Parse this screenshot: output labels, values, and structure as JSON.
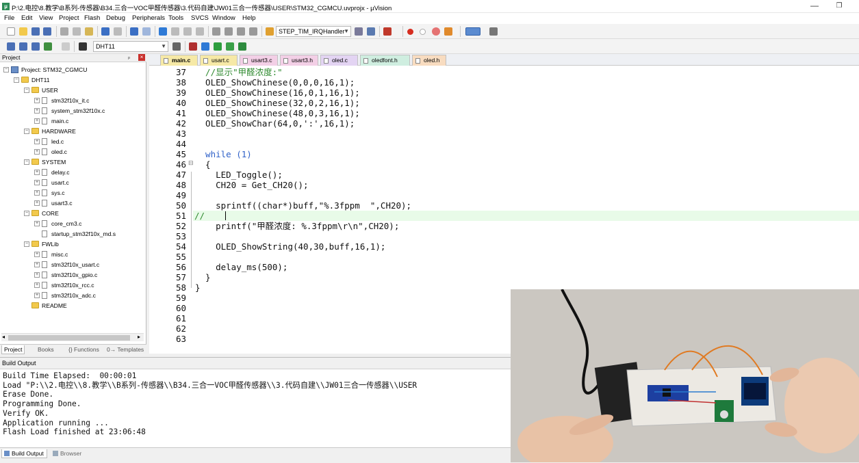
{
  "window": {
    "title": "P:\\2.电控\\8.教学\\B系列-传感器\\B34.三合一VOC甲醛传感器\\3.代码自建\\JW01三合一传感器\\USER\\STM32_CGMCU.uvprojx - µVision",
    "minimize_glyph": "—",
    "restore_glyph": "❐"
  },
  "menu": [
    "File",
    "Edit",
    "View",
    "Project",
    "Flash",
    "Debug",
    "Peripherals",
    "Tools",
    "SVCS",
    "Window",
    "Help"
  ],
  "toolbar": {
    "function_combo": "STEP_TIM_IRQHandler",
    "target_combo": "DHT11"
  },
  "project": {
    "panel_title": "Project",
    "pin_glyph": "ᵖ",
    "close_glyph": "×",
    "root": "Project: STM32_CGMCU",
    "target": "DHT11",
    "groups": [
      {
        "name": "USER",
        "files": [
          "stm32f10x_it.c",
          "system_stm32f10x.c",
          "main.c"
        ]
      },
      {
        "name": "HARDWARE",
        "files": [
          "led.c",
          "oled.c"
        ]
      },
      {
        "name": "SYSTEM",
        "files": [
          "delay.c",
          "usart.c",
          "sys.c",
          "usart3.c"
        ]
      },
      {
        "name": "CORE",
        "files": [
          "core_cm3.c",
          "startup_stm32f10x_md.s"
        ]
      },
      {
        "name": "FWLib",
        "files": [
          "misc.c",
          "stm32f10x_usart.c",
          "stm32f10x_gpio.c",
          "stm32f10x_rcc.c",
          "stm32f10x_adc.c"
        ]
      },
      {
        "name": "README",
        "files": []
      }
    ],
    "tabs": [
      "Project",
      "Books",
      "{} Functions",
      "0→ Templates"
    ]
  },
  "editor": {
    "tabs": [
      {
        "label": "main.c",
        "color": "#f6e9a6",
        "active": true
      },
      {
        "label": "usart.c",
        "color": "#f6e9a6",
        "active": false
      },
      {
        "label": "usart3.c",
        "color": "#f3cfe6",
        "active": false
      },
      {
        "label": "usart3.h",
        "color": "#f3cfe6",
        "active": false
      },
      {
        "label": "oled.c",
        "color": "#e3d4f3",
        "active": false
      },
      {
        "label": "oledfont.h",
        "color": "#cfeee0",
        "active": false
      },
      {
        "label": "oled.h",
        "color": "#f8dcc0",
        "active": false
      }
    ],
    "fold_markers": [
      "⊟",
      "⊟"
    ],
    "code_lines": [
      {
        "n": "37",
        "text": "  //显示\"甲醛浓度:\""
      },
      {
        "n": "38",
        "text": "  OLED_ShowChinese(0,0,0,16,1);"
      },
      {
        "n": "39",
        "text": "  OLED_ShowChinese(16,0,1,16,1);"
      },
      {
        "n": "40",
        "text": "  OLED_ShowChinese(32,0,2,16,1);"
      },
      {
        "n": "41",
        "text": "  OLED_ShowChinese(48,0,3,16,1);"
      },
      {
        "n": "42",
        "text": "  OLED_ShowChar(64,0,':',16,1);"
      },
      {
        "n": "43",
        "text": ""
      },
      {
        "n": "44",
        "text": ""
      },
      {
        "n": "45",
        "text": "  while (1)"
      },
      {
        "n": "46",
        "text": "  {"
      },
      {
        "n": "47",
        "text": "    LED_Toggle();"
      },
      {
        "n": "48",
        "text": "    CH20 = Get_CH20();"
      },
      {
        "n": "49",
        "text": ""
      },
      {
        "n": "50",
        "text": "    sprintf((char*)buff,\"%.3fppm  \",CH20);"
      },
      {
        "n": "51",
        "text": "//"
      },
      {
        "n": "52",
        "text": "    printf(\"甲醛浓度: %.3fppm\\r\\n\",CH20);"
      },
      {
        "n": "53",
        "text": ""
      },
      {
        "n": "54",
        "text": "    OLED_ShowString(40,30,buff,16,1);"
      },
      {
        "n": "55",
        "text": ""
      },
      {
        "n": "56",
        "text": "    delay_ms(500);"
      },
      {
        "n": "57",
        "text": "  }"
      },
      {
        "n": "58",
        "text": "}"
      },
      {
        "n": "59",
        "text": ""
      },
      {
        "n": "60",
        "text": ""
      },
      {
        "n": "61",
        "text": ""
      },
      {
        "n": "62",
        "text": ""
      },
      {
        "n": "63",
        "text": ""
      }
    ]
  },
  "build": {
    "title": "Build Output",
    "lines": [
      "Build Time Elapsed:  00:00:01",
      "Load \"P:\\\\2.电控\\\\8.教学\\\\B系列-传感器\\\\B34.三合一VOC甲醛传感器\\\\3.代码自建\\\\JW01三合一传感器\\\\USER",
      "Erase Done.",
      "Programming Done.",
      "Verify OK.",
      "Application running ...",
      "Flash Load finished at 23:06:48"
    ],
    "tabs": [
      "Build Output",
      "Browser"
    ]
  },
  "colors": {
    "keyword": "#2e60c8",
    "comment": "#2f8a2f",
    "string": "#7b2aa8",
    "current_line": "#e8fbe8"
  }
}
